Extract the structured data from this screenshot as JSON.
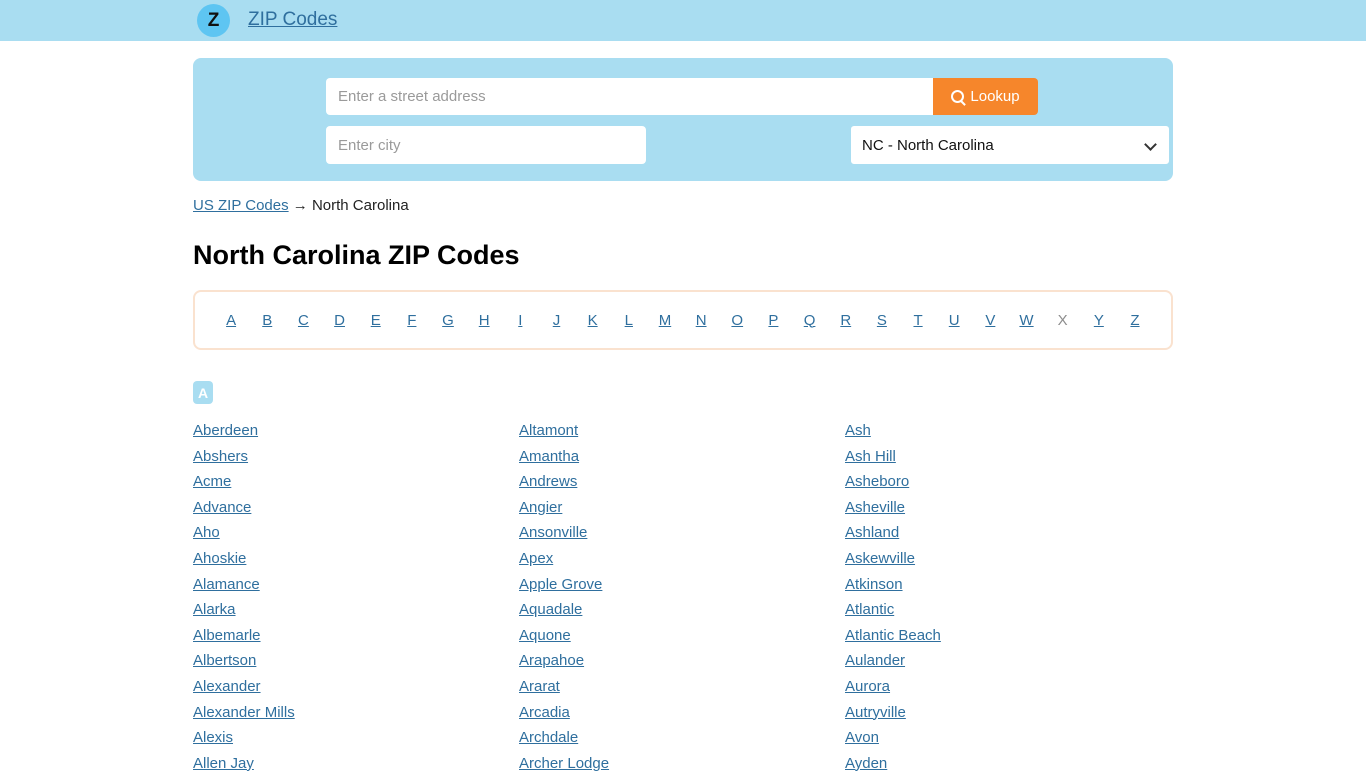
{
  "header": {
    "logo_letter": "Z",
    "brand": "ZIP Codes"
  },
  "search": {
    "address_placeholder": "Enter a street address",
    "address_value": "",
    "city_placeholder": "Enter city",
    "city_value": "",
    "state_selected": "NC - North Carolina",
    "lookup_label": "Lookup",
    "search_icon": "search-icon",
    "chevron_icon": "chevron-down-icon",
    "accent_color": "#f6862b",
    "panel_color": "#a9ddf1"
  },
  "breadcrumb": {
    "root": "US ZIP Codes",
    "separator": "→",
    "current": "North Carolina"
  },
  "page": {
    "title": "North Carolina ZIP Codes"
  },
  "alphabet": {
    "letters": [
      {
        "label": "A",
        "enabled": true
      },
      {
        "label": "B",
        "enabled": true
      },
      {
        "label": "C",
        "enabled": true
      },
      {
        "label": "D",
        "enabled": true
      },
      {
        "label": "E",
        "enabled": true
      },
      {
        "label": "F",
        "enabled": true
      },
      {
        "label": "G",
        "enabled": true
      },
      {
        "label": "H",
        "enabled": true
      },
      {
        "label": "I",
        "enabled": true
      },
      {
        "label": "J",
        "enabled": true
      },
      {
        "label": "K",
        "enabled": true
      },
      {
        "label": "L",
        "enabled": true
      },
      {
        "label": "M",
        "enabled": true
      },
      {
        "label": "N",
        "enabled": true
      },
      {
        "label": "O",
        "enabled": true
      },
      {
        "label": "P",
        "enabled": true
      },
      {
        "label": "Q",
        "enabled": true
      },
      {
        "label": "R",
        "enabled": true
      },
      {
        "label": "S",
        "enabled": true
      },
      {
        "label": "T",
        "enabled": true
      },
      {
        "label": "U",
        "enabled": true
      },
      {
        "label": "V",
        "enabled": true
      },
      {
        "label": "W",
        "enabled": true
      },
      {
        "label": "X",
        "enabled": false
      },
      {
        "label": "Y",
        "enabled": true
      },
      {
        "label": "Z",
        "enabled": true
      }
    ],
    "border_color": "#fae2cf"
  },
  "section": {
    "letter": "A",
    "badge_color": "#a9ddf1",
    "columns": [
      [
        "Aberdeen",
        "Abshers",
        "Acme",
        "Advance",
        "Aho",
        "Ahoskie",
        "Alamance",
        "Alarka",
        "Albemarle",
        "Albertson",
        "Alexander",
        "Alexander Mills",
        "Alexis",
        "Allen Jay"
      ],
      [
        "Altamont",
        "Amantha",
        "Andrews",
        "Angier",
        "Ansonville",
        "Apex",
        "Apple Grove",
        "Aquadale",
        "Aquone",
        "Arapahoe",
        "Ararat",
        "Arcadia",
        "Archdale",
        "Archer Lodge"
      ],
      [
        "Ash",
        "Ash Hill",
        "Asheboro",
        "Asheville",
        "Ashland",
        "Askewville",
        "Atkinson",
        "Atlantic",
        "Atlantic Beach",
        "Aulander",
        "Aurora",
        "Autryville",
        "Avon",
        "Ayden"
      ]
    ]
  },
  "link_color": "#2f6f9e"
}
